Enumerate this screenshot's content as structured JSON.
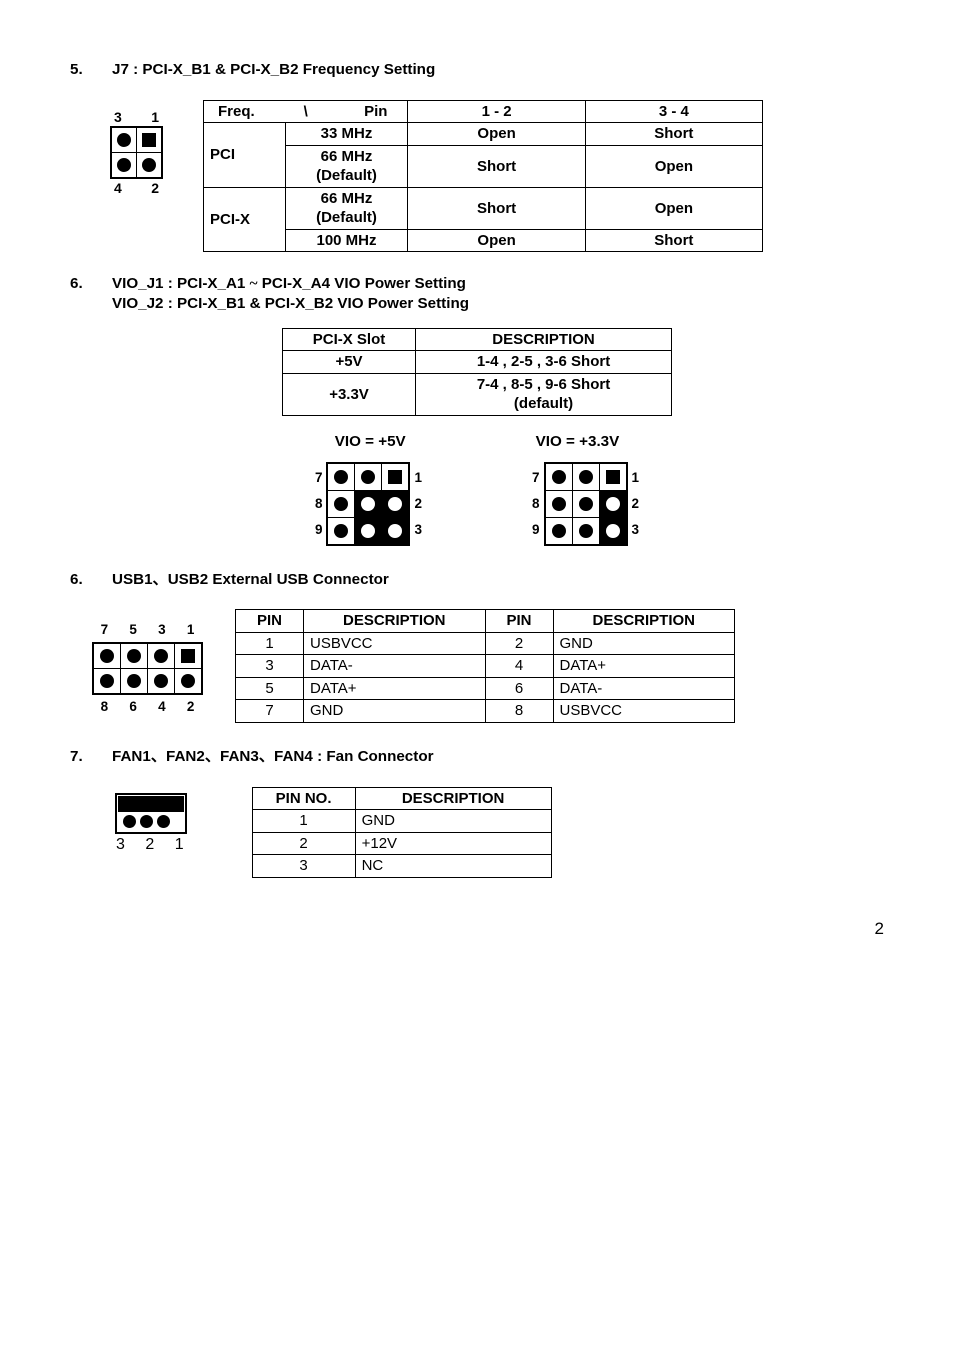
{
  "section5": {
    "num": "5.",
    "title": "J7 : PCI-X_B1 & PCI-X_B2 Frequency Setting",
    "jumperLabels": {
      "tl": "3",
      "tr": "1",
      "bl": "4",
      "br": "2"
    },
    "headers": {
      "freq": "Freq.",
      "pin": "Pin",
      "p12": "1 - 2",
      "p34": "3 - 4"
    },
    "rows": [
      {
        "bus": "PCI",
        "freq": "33 MHz",
        "p12": "Open",
        "p34": "Short"
      },
      {
        "bus": "",
        "freq": "66 MHz (Default)",
        "p12": "Short",
        "p34": "Open"
      },
      {
        "bus": "PCI-X",
        "freq": "66 MHz (Default)",
        "p12": "Short",
        "p34": "Open"
      },
      {
        "bus": "",
        "freq": "100 MHz",
        "p12": "Open",
        "p34": "Short"
      }
    ]
  },
  "section6a": {
    "num": "6.",
    "titleLine1": "VIO_J1 : PCI-X_A1 ~ PCI-X_A4 VIO Power Setting",
    "titleLine2": "VIO_J2 : PCI-X_B1 & PCI-X_B2 VIO Power Setting",
    "headers": {
      "slot": "PCI-X Slot",
      "desc": "DESCRIPTION"
    },
    "rows": [
      {
        "slot": "+5V",
        "desc": "1-4 , 2-5 , 3-6 Short"
      },
      {
        "slot": "+3.3V",
        "desc": "7-4 , 8-5 , 9-6 Short (default)"
      }
    ],
    "label5v": "VIO = +5V",
    "label33v": "VIO = +3.3V",
    "leftNums": [
      "7",
      "8",
      "9"
    ],
    "rightNums": [
      "1",
      "2",
      "3"
    ]
  },
  "section6b": {
    "num": "6.",
    "title": "USB1、USB2 External USB Connector",
    "topLabels": [
      "7",
      "5",
      "3",
      "1"
    ],
    "botLabels": [
      "8",
      "6",
      "4",
      "2"
    ],
    "headers": {
      "pin": "PIN",
      "desc": "DESCRIPTION"
    },
    "rows": [
      {
        "p1": "1",
        "d1": "USBVCC",
        "p2": "2",
        "d2": "GND"
      },
      {
        "p1": "3",
        "d1": "DATA-",
        "p2": "4",
        "d2": "DATA+"
      },
      {
        "p1": "5",
        "d1": "DATA+",
        "p2": "6",
        "d2": "DATA-"
      },
      {
        "p1": "7",
        "d1": "GND",
        "p2": "8",
        "d2": "USBVCC"
      }
    ]
  },
  "section7": {
    "num": "7.",
    "title": "FAN1、FAN2、FAN3、FAN4 : Fan Connector",
    "pinLabels": "3 2 1",
    "headers": {
      "pin": "PIN NO.",
      "desc": "DESCRIPTION"
    },
    "rows": [
      {
        "pin": "1",
        "desc": "GND"
      },
      {
        "pin": "2",
        "desc": "+12V"
      },
      {
        "pin": "3",
        "desc": "NC"
      }
    ]
  },
  "pageNumber": "2"
}
